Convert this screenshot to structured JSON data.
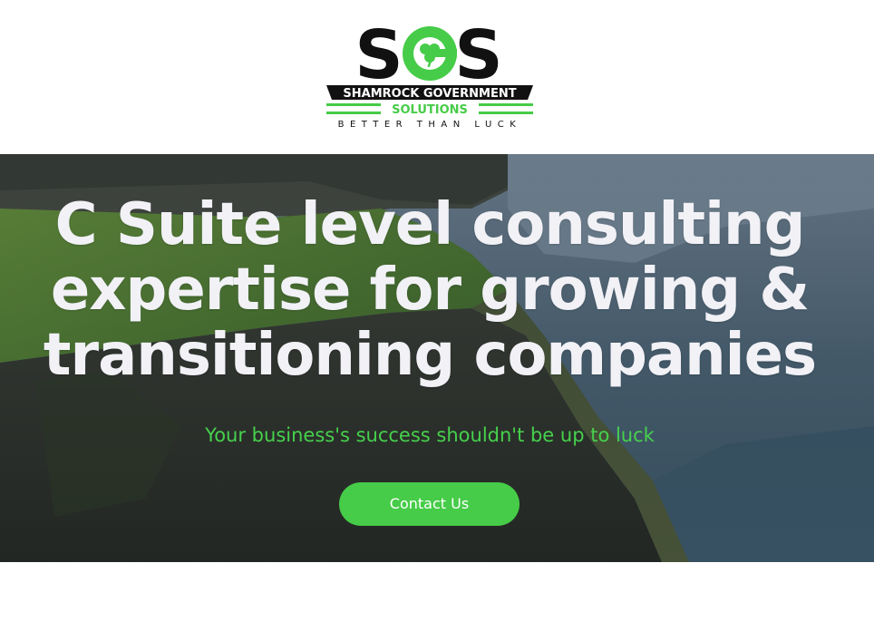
{
  "header": {
    "logo": {
      "monogram": "SGS",
      "company_name": "SHAMROCK GOVERNMENT",
      "company_sub": "SOLUTIONS",
      "tagline": "BETTER THAN LUCK"
    }
  },
  "hero": {
    "title_lines": [
      "C Suite level consulting",
      "expertise for growing &",
      "transitioning companies"
    ],
    "subtitle": "Your business's success shouldn't be up to luck",
    "cta_label": "Contact Us"
  },
  "colors": {
    "brand_green": "#46cc48",
    "logo_black": "#111111",
    "headline": "#f1f1f6"
  },
  "icons": {
    "logo_center": "shamrock-icon"
  }
}
